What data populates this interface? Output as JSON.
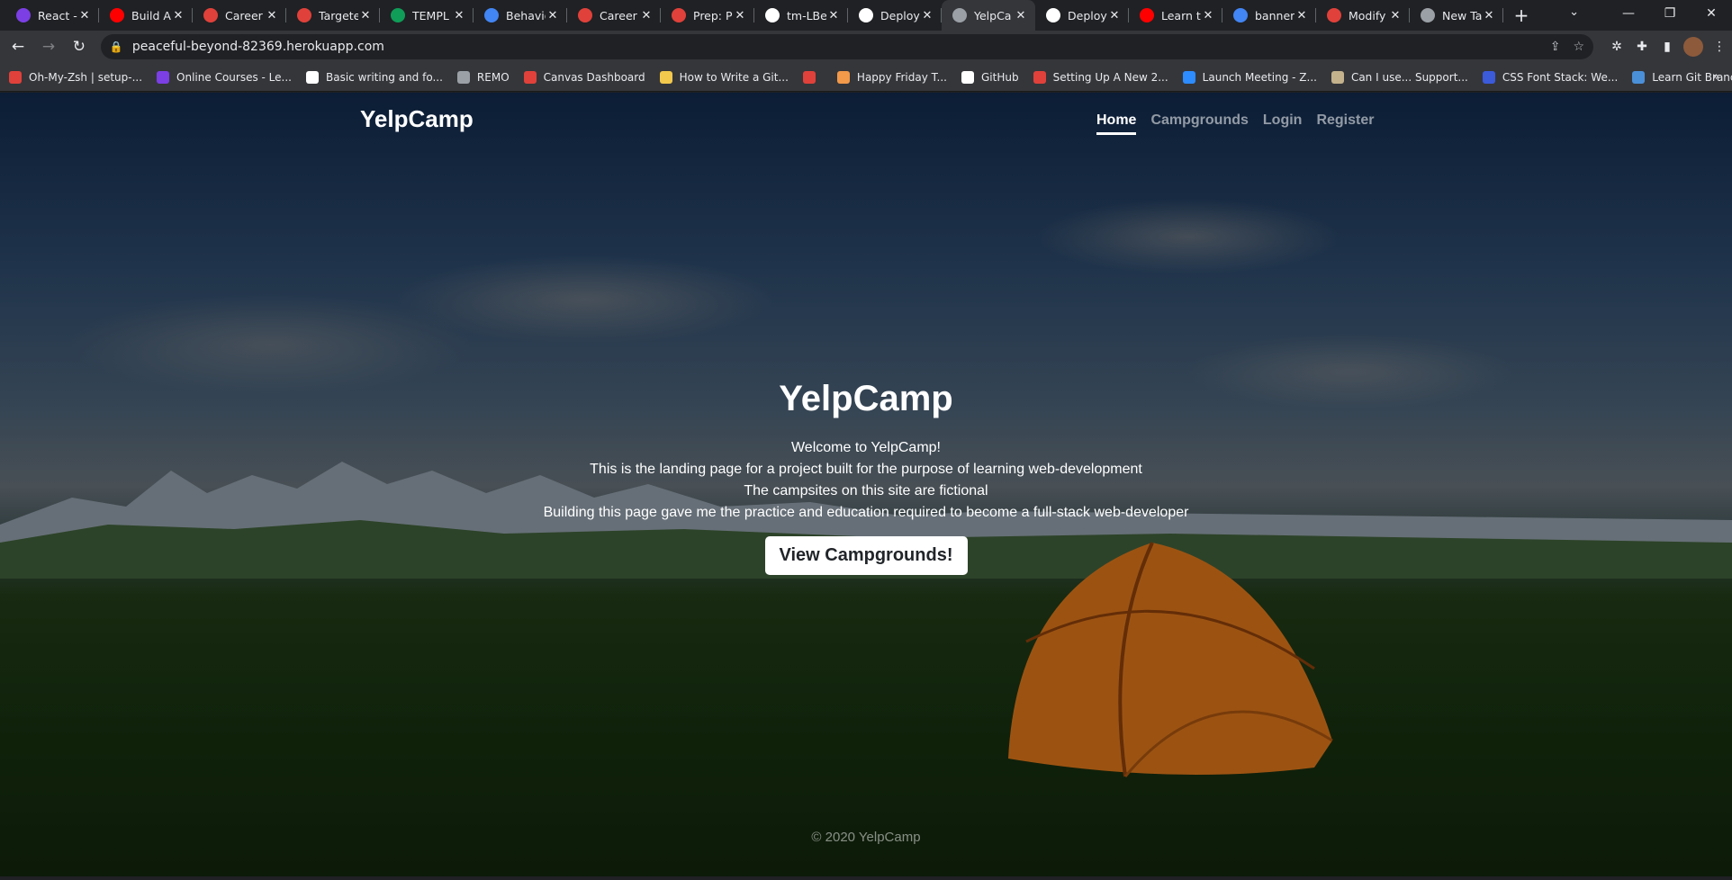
{
  "browser": {
    "tabs": [
      {
        "title": "React -",
        "favicon_color": "#7b3fe4",
        "favicon": "react-icon"
      },
      {
        "title": "Build A",
        "favicon_color": "#ff0000",
        "favicon": "youtube-icon"
      },
      {
        "title": "Career",
        "favicon_color": "#e0413a",
        "favicon": "career-icon"
      },
      {
        "title": "Targete",
        "favicon_color": "#e0413a",
        "favicon": "target-icon"
      },
      {
        "title": "TEMPL",
        "favicon_color": "#0f9d58",
        "favicon": "sheets-icon"
      },
      {
        "title": "Behavio",
        "favicon_color": "#4285f4",
        "favicon": "docs-icon"
      },
      {
        "title": "Career",
        "favicon_color": "#e0413a",
        "favicon": "career-icon"
      },
      {
        "title": "Prep: P",
        "favicon_color": "#e0413a",
        "favicon": "career-icon"
      },
      {
        "title": "tm-LBe",
        "favicon_color": "#ffffff",
        "favicon": "github-icon"
      },
      {
        "title": "Deploy",
        "favicon_color": "#ffffff",
        "favicon": "github-icon"
      },
      {
        "title": "YelpCa",
        "favicon_color": "#9aa0a6",
        "favicon": "globe-icon",
        "active": true
      },
      {
        "title": "Deploy",
        "favicon_color": "#ffffff",
        "favicon": "github-icon"
      },
      {
        "title": "Learn t",
        "favicon_color": "#ff0000",
        "favicon": "youtube-icon"
      },
      {
        "title": "banner",
        "favicon_color": "#4285f4",
        "favicon": "google-icon"
      },
      {
        "title": "Modify",
        "favicon_color": "#e0413a",
        "favicon": "adobe-icon"
      },
      {
        "title": "New Ta",
        "favicon_color": "#9aa0a6",
        "favicon": "chrome-icon"
      }
    ],
    "url": "peaceful-beyond-82369.herokuapp.com",
    "bookmarks": [
      {
        "label": "Oh-My-Zsh | setup-...",
        "color": "#e0413a"
      },
      {
        "label": "Online Courses - Le...",
        "color": "#7b3fe4"
      },
      {
        "label": "Basic writing and fo...",
        "color": "#ffffff"
      },
      {
        "label": "REMO",
        "color": "#9aa0a6"
      },
      {
        "label": "Canvas Dashboard",
        "color": "#e0413a"
      },
      {
        "label": "How to Write a Git...",
        "color": "#f2c94c"
      },
      {
        "label": "",
        "color": "#e0413a"
      },
      {
        "label": "Happy Friday T...",
        "color": "#f2994a"
      },
      {
        "label": "GitHub",
        "color": "#ffffff"
      },
      {
        "label": "Setting Up A New 2...",
        "color": "#e0413a"
      },
      {
        "label": "Launch Meeting - Z...",
        "color": "#2d8cff"
      },
      {
        "label": "Can I use... Support...",
        "color": "#c3b28c"
      },
      {
        "label": "CSS Font Stack: We...",
        "color": "#3b5bdb"
      },
      {
        "label": "Learn Git Branching",
        "color": "#4a90d9"
      }
    ]
  },
  "site": {
    "brand": "YelpCamp",
    "nav": {
      "home": "Home",
      "campgrounds": "Campgrounds",
      "login": "Login",
      "register": "Register"
    },
    "hero": {
      "title": "YelpCamp",
      "line1": "Welcome to YelpCamp!",
      "line2": "This is the landing page for a project built for the purpose of learning web-development",
      "line3": "The campsites on this site are fictional",
      "line4": "Building this page gave me the practice and education required to become a full-stack web-developer",
      "cta": "View Campgrounds!"
    },
    "footer": "© 2020 YelpCamp"
  }
}
